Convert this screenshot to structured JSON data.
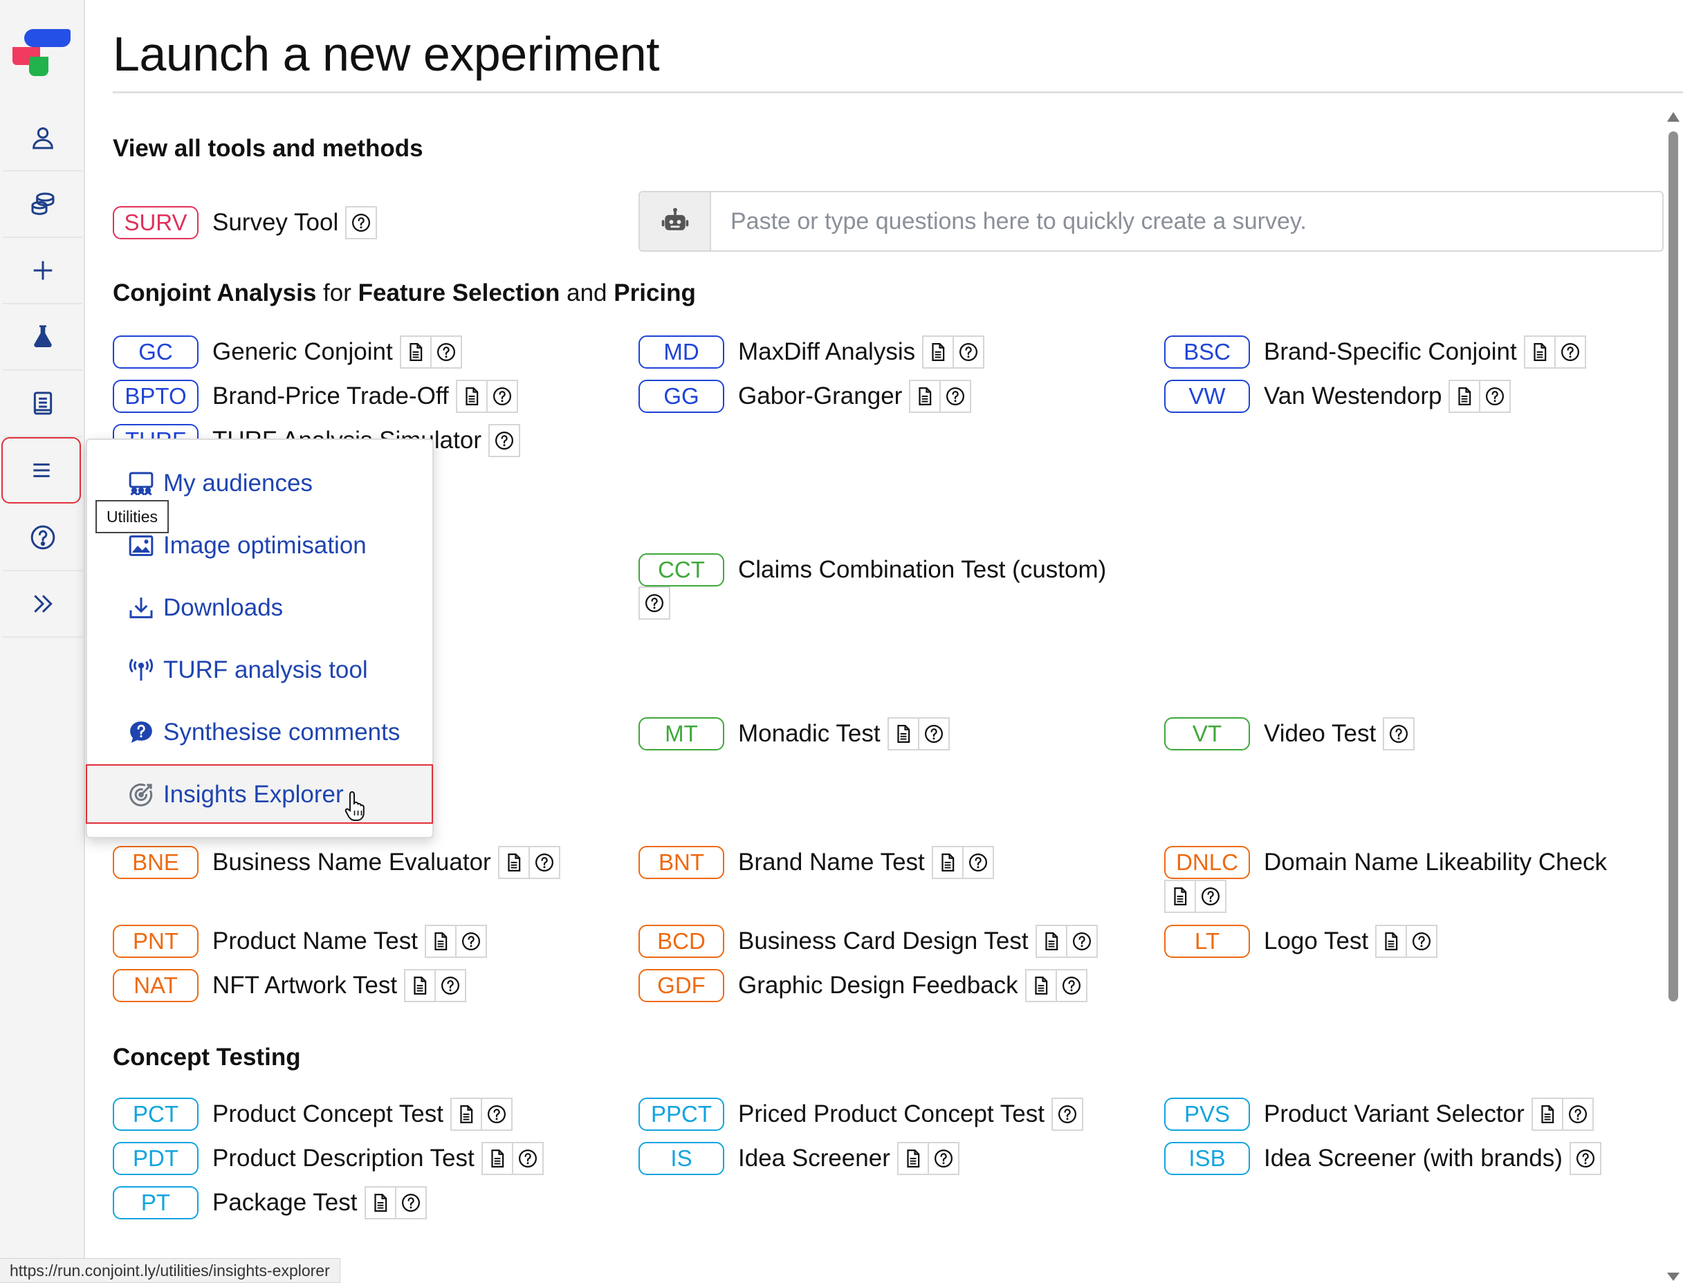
{
  "page": {
    "title": "Launch a new experiment",
    "status_url": "https://run.conjoint.ly/utilities/insights-explorer"
  },
  "sidebar": {
    "icons": [
      "user-icon",
      "coins-icon",
      "plus-icon",
      "flask-icon",
      "book-icon",
      "menu-icon",
      "help-icon",
      "chevrons-right-icon"
    ],
    "active": "menu-icon",
    "tooltip": "Utilities"
  },
  "sections": {
    "all_tools": "View all tools and methods",
    "conjoint": {
      "p1": "Conjoint Analysis",
      "p2": "for",
      "p3": "Feature Selection",
      "p4": "and",
      "p5": "Pricing"
    },
    "concept": "Concept Testing"
  },
  "survey": {
    "badge": "SURV",
    "name": "Survey Tool",
    "placeholder": "Paste or type questions here to quickly create a survey."
  },
  "tools": {
    "gc": {
      "badge": "GC",
      "name": "Generic Conjoint"
    },
    "md": {
      "badge": "MD",
      "name": "MaxDiff Analysis"
    },
    "bsc": {
      "badge": "BSC",
      "name": "Brand-Specific Conjoint"
    },
    "bpto": {
      "badge": "BPTO",
      "name": "Brand-Price Trade-Off"
    },
    "gg": {
      "badge": "GG",
      "name": "Gabor-Granger"
    },
    "vw": {
      "badge": "VW",
      "name": "Van Westendorp"
    },
    "turf": {
      "badge": "TURF",
      "name": "TURF Analysis Simulator"
    },
    "cct": {
      "badge": "CCT",
      "name": "Claims Combination Test (custom)"
    },
    "mt": {
      "badge": "MT",
      "name": "Monadic Test"
    },
    "vt": {
      "badge": "VT",
      "name": "Video Test"
    },
    "bne": {
      "badge": "BNE",
      "name": "Business Name Evaluator"
    },
    "bnt": {
      "badge": "BNT",
      "name": "Brand Name Test"
    },
    "dnlc": {
      "badge": "DNLC",
      "name": "Domain Name Likeability Check"
    },
    "pnt": {
      "badge": "PNT",
      "name": "Product Name Test"
    },
    "bcd": {
      "badge": "BCD",
      "name": "Business Card Design Test"
    },
    "lt": {
      "badge": "LT",
      "name": "Logo Test"
    },
    "nat": {
      "badge": "NAT",
      "name": "NFT Artwork Test"
    },
    "gdf": {
      "badge": "GDF",
      "name": "Graphic Design Feedback"
    },
    "pct": {
      "badge": "PCT",
      "name": "Product Concept Test"
    },
    "ppct": {
      "badge": "PPCT",
      "name": "Priced Product Concept Test"
    },
    "pvs": {
      "badge": "PVS",
      "name": "Product Variant Selector"
    },
    "pdt": {
      "badge": "PDT",
      "name": "Product Description Test"
    },
    "is": {
      "badge": "IS",
      "name": "Idea Screener"
    },
    "isb": {
      "badge": "ISB",
      "name": "Idea Screener (with brands)"
    },
    "pt": {
      "badge": "PT",
      "name": "Package Test"
    }
  },
  "menu": {
    "items": [
      {
        "label": "My audiences",
        "icon": "audience-icon"
      },
      {
        "label": "Image optimisation",
        "icon": "image-icon"
      },
      {
        "label": "Downloads",
        "icon": "download-icon"
      },
      {
        "label": "TURF analysis tool",
        "icon": "antenna-icon"
      },
      {
        "label": "Synthesise comments",
        "icon": "chat-question-icon"
      },
      {
        "label": "Insights Explorer",
        "icon": "insights-target-icon"
      }
    ],
    "hovered": "Insights Explorer"
  },
  "colors": {
    "red": "#e0315a",
    "blue": "#1f44d6",
    "green": "#3fa83a",
    "orange": "#ee6a12",
    "cyan": "#12a4e0",
    "highlight_border": "#e0313b",
    "menu_text": "#1f44b0"
  }
}
